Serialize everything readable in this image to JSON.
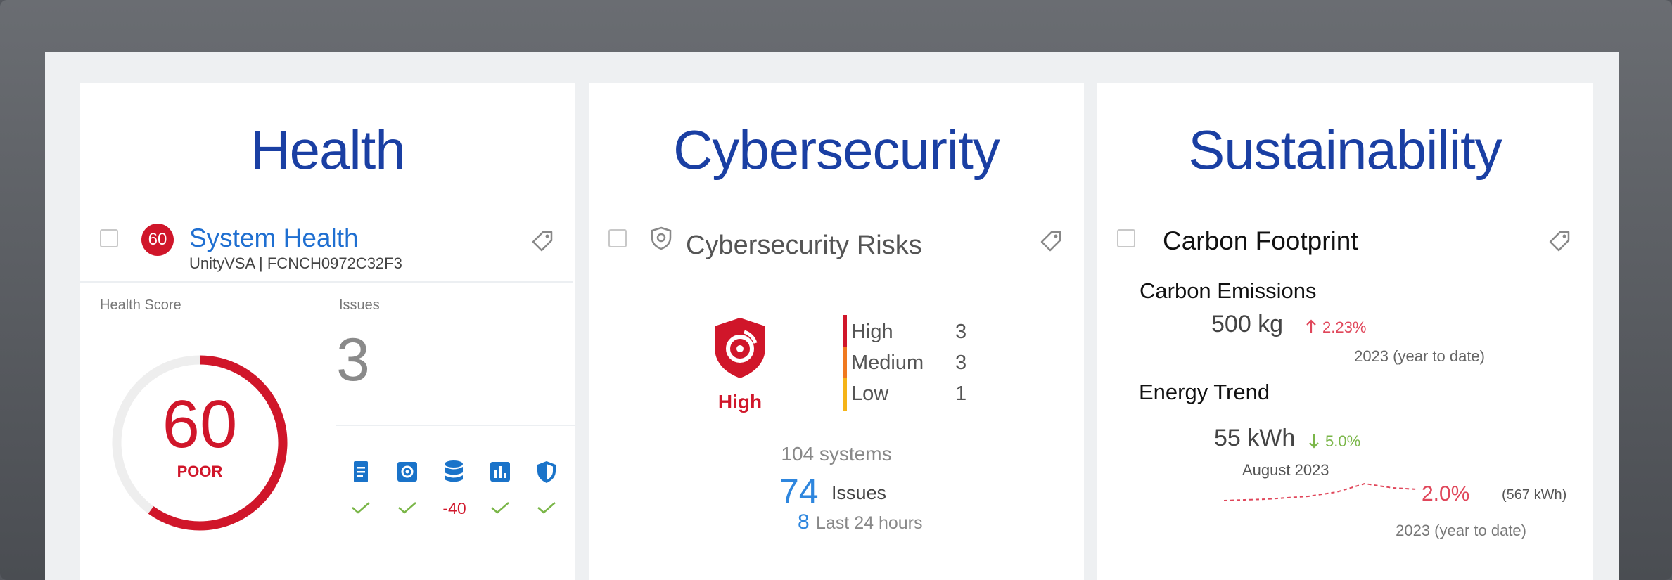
{
  "sections": {
    "health": {
      "title": "Health",
      "card_title": "System Health",
      "score_badge": "60",
      "subtitle": "UnityVSA | FCNCH0972C32F3",
      "health_score_label": "Health Score",
      "score": "60",
      "score_fraction": 0.6,
      "score_status": "POOR",
      "issues_label": "Issues",
      "issues_count": "3",
      "category_icons": [
        {
          "icon": "document-icon",
          "status": "check"
        },
        {
          "icon": "gear-icon",
          "status": "check"
        },
        {
          "icon": "database-icon",
          "status": "-40"
        },
        {
          "icon": "bar-chart-icon",
          "status": "check"
        },
        {
          "icon": "shield-icon",
          "status": "check"
        }
      ],
      "penalty_value": "-40"
    },
    "cybersecurity": {
      "title": "Cybersecurity",
      "card_title": "Cybersecurity Risks",
      "overall_risk": "High",
      "levels": [
        {
          "name": "High",
          "count": "3",
          "color": "#d0162a"
        },
        {
          "name": "Medium",
          "count": "3",
          "color": "#f0791f"
        },
        {
          "name": "Low",
          "count": "1",
          "color": "#f5b418"
        }
      ],
      "systems": "104 systems",
      "issues_count": "74",
      "issues_label": "Issues",
      "recent_count": "8",
      "recent_label": "Last 24 hours"
    },
    "sustainability": {
      "title": "Sustainability",
      "card_title": "Carbon Footprint",
      "emissions_label": "Carbon Emissions",
      "emissions_value": "500 kg",
      "emissions_change": "2.23%",
      "emissions_period": "2023 (year to date)",
      "energy_label": "Energy Trend",
      "energy_value": "55 kWh",
      "energy_change": "5.0%",
      "month_label": "August 2023",
      "trend_percent": "2.0%",
      "trend_kwh": "(567 kWh)",
      "trend_period": "2023 (year to date)"
    }
  },
  "colors": {
    "title_blue": "#1a3fa3",
    "link_blue": "#1f6fd1",
    "alert_red": "#d0162a",
    "ok_green": "#7ab648",
    "icon_blue": "#1a73c9"
  }
}
